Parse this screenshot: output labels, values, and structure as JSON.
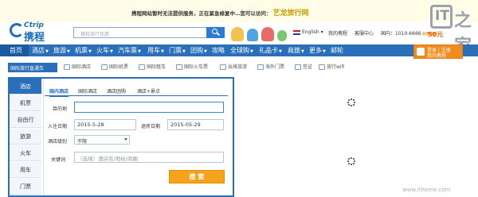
{
  "notice": {
    "text": "携程网站暂时无法提供服务，正在紧急修复中…您可以访问：",
    "link": "艺龙旅行网"
  },
  "watermark_logo": {
    "letters": "IT",
    "zh": "之家"
  },
  "header": {
    "logo_en": "Ctrip",
    "logo_zh": "携程",
    "search_placeholder": "搜我旅行优惠",
    "language": "English",
    "my_ctrip": "我的携程",
    "service": "客服中心",
    "phone": "国内：1010-6666",
    "promo_badge": "50元",
    "promo_sub": "劲爆特惠"
  },
  "mainnav": {
    "items": [
      {
        "label": "首页",
        "arrow": ""
      },
      {
        "label": "酒店",
        "arrow": "▼"
      },
      {
        "label": "旅游",
        "arrow": "▼"
      },
      {
        "label": "机票",
        "arrow": "▼"
      },
      {
        "label": "火车",
        "arrow": "▼"
      },
      {
        "label": "汽车票",
        "arrow": "▼"
      },
      {
        "label": "用车",
        "arrow": "▼"
      },
      {
        "label": "门票",
        "arrow": "▼"
      },
      {
        "label": "团购",
        "arrow": "▼"
      },
      {
        "label": "攻略",
        "arrow": ""
      },
      {
        "label": "全球购",
        "arrow": "▼"
      },
      {
        "label": "礼品卡",
        "arrow": "▼"
      },
      {
        "label": "商旅",
        "arrow": "▼"
      },
      {
        "label": "更多",
        "arrow": "▼"
      },
      {
        "label": "邮轮",
        "arrow": ""
      }
    ],
    "login_line1": "登录 | 注册",
    "login_line2": "我的携程"
  },
  "subnav": {
    "label": "国际旅行直通车",
    "items": [
      "国际酒店",
      "国际机票",
      "国际租车",
      "国际火车票",
      "出境旅游",
      "海外门票",
      "签证",
      "旅行wifi"
    ]
  },
  "panel": {
    "vtabs": [
      "酒店",
      "机票",
      "自由行",
      "旅游",
      "火车",
      "用车",
      "门票"
    ],
    "htabs": [
      "国内酒店",
      "国际酒店",
      "酒店团购",
      "酒店+景点"
    ],
    "destination_label": "目的地",
    "destination_value": "",
    "checkin_label": "入住日期",
    "checkin_value": "2015-5-28",
    "checkout_label": "退房日期",
    "checkout_value": "2015-05-29",
    "level_label": "酒店级别",
    "level_value": "不限",
    "keyword_label": "关键词",
    "keyword_placeholder": "（选填）酒店名/地标/商圈",
    "submit_label": "搜 索"
  },
  "footer_watermark": "www.ithome.com"
}
